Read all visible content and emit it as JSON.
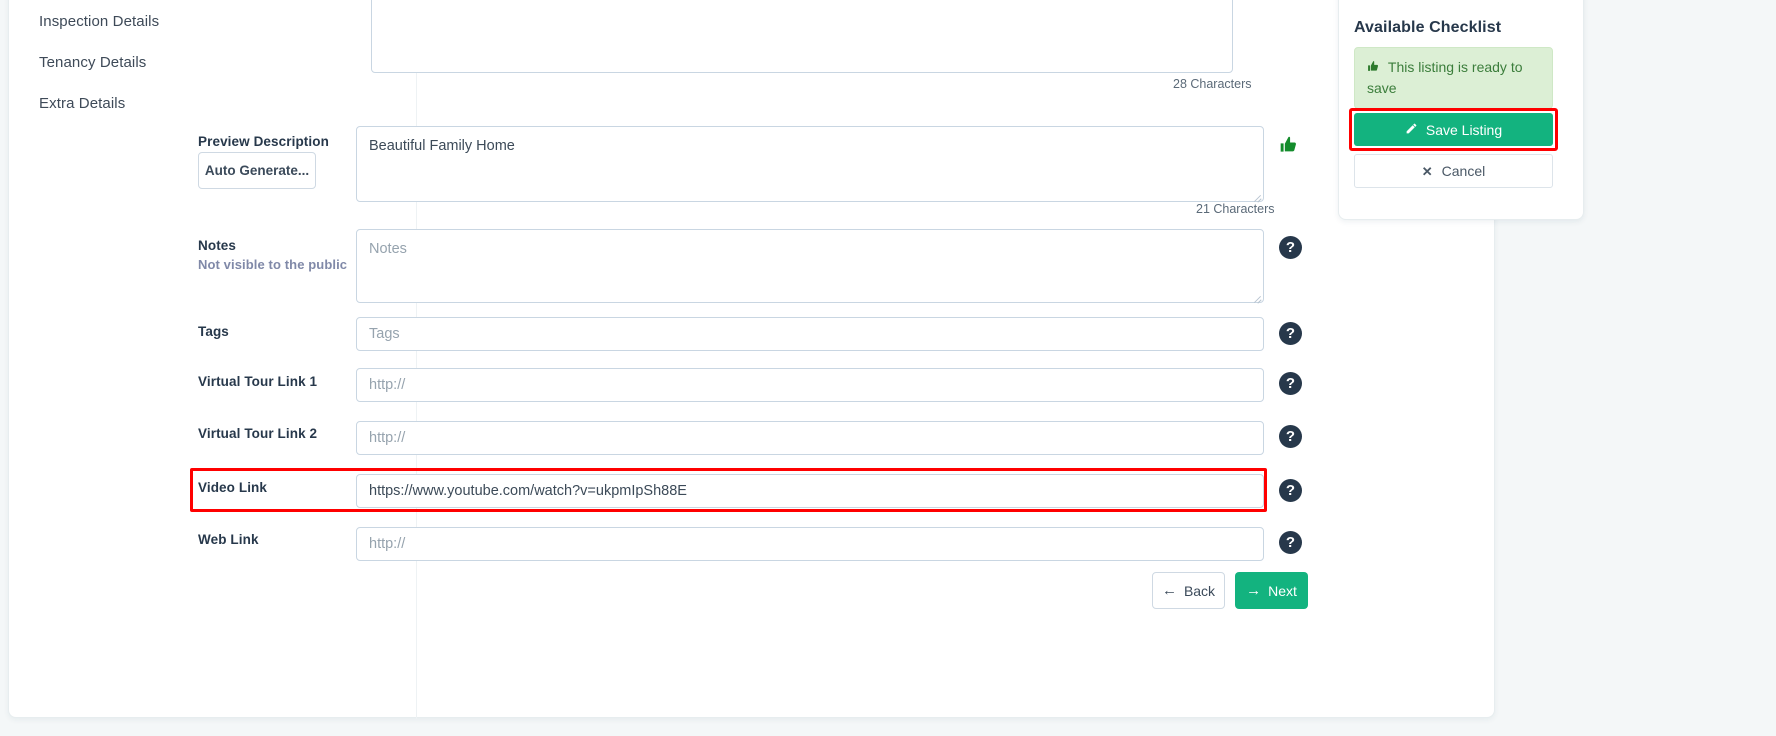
{
  "sidebar": {
    "items": [
      {
        "label": "Inspection Details"
      },
      {
        "label": "Tenancy Details"
      },
      {
        "label": "Extra Details"
      }
    ]
  },
  "counters": {
    "description": "28 Characters",
    "preview_description": "21 Characters"
  },
  "form": {
    "auto_generate_label": "Auto Generate...",
    "fields": [
      {
        "label": "Preview Description",
        "sublabel": "",
        "value": "Beautiful Family Home",
        "placeholder": "",
        "type": "textarea"
      },
      {
        "label": "Notes",
        "sublabel": "Not visible to the public",
        "value": "",
        "placeholder": "Notes",
        "type": "textarea"
      },
      {
        "label": "Tags",
        "sublabel": "",
        "value": "",
        "placeholder": "Tags",
        "type": "input"
      },
      {
        "label": "Virtual Tour Link 1",
        "sublabel": "",
        "value": "",
        "placeholder": "http://",
        "type": "input"
      },
      {
        "label": "Virtual Tour Link 2",
        "sublabel": "",
        "value": "",
        "placeholder": "http://",
        "type": "input"
      },
      {
        "label": "Video Link",
        "sublabel": "",
        "value": "https://www.youtube.com/watch?v=ukpmIpSh88E",
        "placeholder": "http://",
        "type": "input"
      },
      {
        "label": "Web Link",
        "sublabel": "",
        "value": "",
        "placeholder": "http://",
        "type": "input"
      }
    ],
    "help_icon_glyph": "?",
    "thumbs_up_glyph": "👍"
  },
  "nav_buttons": {
    "back_label": "Back",
    "back_arrow": "←",
    "next_label": "Next",
    "next_arrow": "→"
  },
  "checklist": {
    "title": "Available Checklist",
    "ready_message": "This listing is ready to save",
    "ready_thumb_glyph": "👍",
    "save_label": "Save Listing",
    "save_icon_glyph": "✎",
    "cancel_label": "Cancel",
    "cancel_icon_glyph": "✕"
  },
  "colors": {
    "accent_green": "#13b37f",
    "highlight_red": "#ff0000",
    "ready_bg": "#dcefd5",
    "ready_text": "#3b7d3b",
    "label_text": "#27384b",
    "sublabel_text": "#8089a8"
  }
}
